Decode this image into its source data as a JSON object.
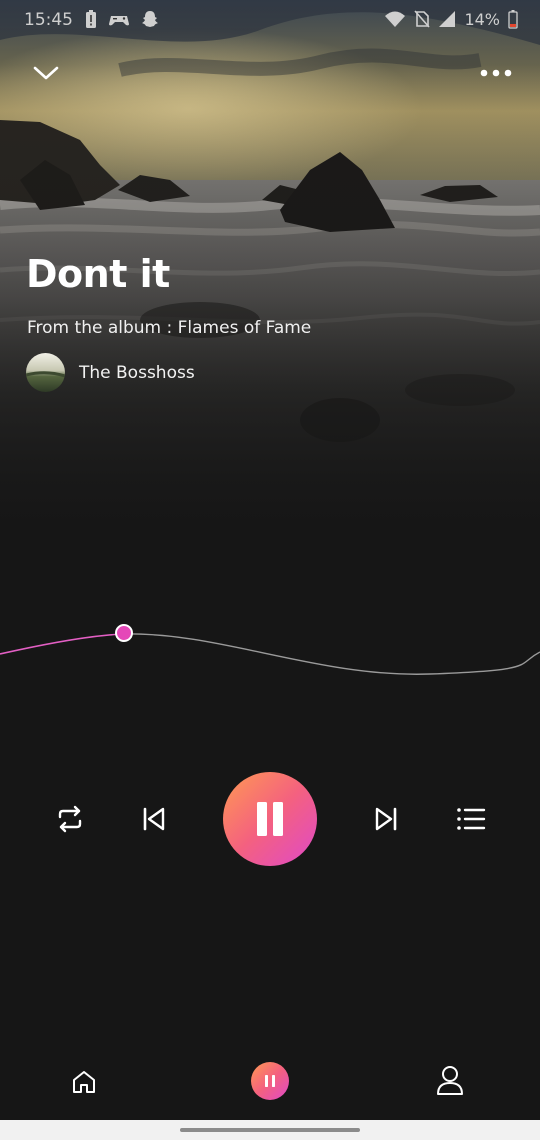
{
  "status_bar": {
    "time": "15:45",
    "battery_percent": "14%",
    "left_icons": [
      "battery-alert-icon",
      "gamepad-icon",
      "snapchat-icon"
    ],
    "right_icons": [
      "wifi-icon",
      "no-sim-icon",
      "signal-icon",
      "battery-low-icon"
    ]
  },
  "header": {
    "collapse_icon": "chevron-down-icon",
    "more_icon": "more-horizontal-icon"
  },
  "track": {
    "title": "Dont it",
    "album_line": "From the album : Flames of Fame",
    "artist": "The Bosshoss",
    "progress_fraction": 0.23
  },
  "controls": {
    "repeat_icon": "repeat-icon",
    "previous_icon": "skip-previous-icon",
    "play_state_icon": "pause-icon",
    "next_icon": "skip-next-icon",
    "queue_icon": "queue-list-icon"
  },
  "bottom_nav": {
    "items": [
      "home-icon",
      "now-playing-pause-icon",
      "profile-icon"
    ]
  },
  "colors": {
    "background": "#161616",
    "accent_start": "#ff9a52",
    "accent_mid": "#f4617f",
    "accent_end": "#df49c9",
    "progress_played": "#e35fc4",
    "progress_remaining": "#9a9a9a"
  }
}
